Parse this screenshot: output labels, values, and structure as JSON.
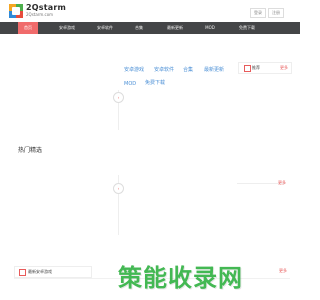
{
  "brand": {
    "name": "2Qstarm",
    "url": "2Qstarm.com"
  },
  "header": {
    "btn_a": "登录",
    "btn_b": "注册"
  },
  "nav": {
    "items": [
      {
        "label": "首页",
        "active": true
      },
      {
        "label": "安卓游戏"
      },
      {
        "label": "安卓软件"
      },
      {
        "label": "合集"
      },
      {
        "label": "最新更新"
      },
      {
        "label": "MOD"
      },
      {
        "label": "免费下载"
      }
    ]
  },
  "tags": [
    "安卓游戏",
    "安卓软件",
    "合集",
    "最新更新",
    "MOD",
    "免费下载"
  ],
  "panel": {
    "label": "推荐",
    "more": "更多"
  },
  "hot": {
    "title": "热门精选"
  },
  "side_icons": [
    "›",
    "‹"
  ],
  "divider_tag": "更多",
  "footer": {
    "label": "最新安卓游戏",
    "more": "更多"
  },
  "watermark": "策能收录网"
}
